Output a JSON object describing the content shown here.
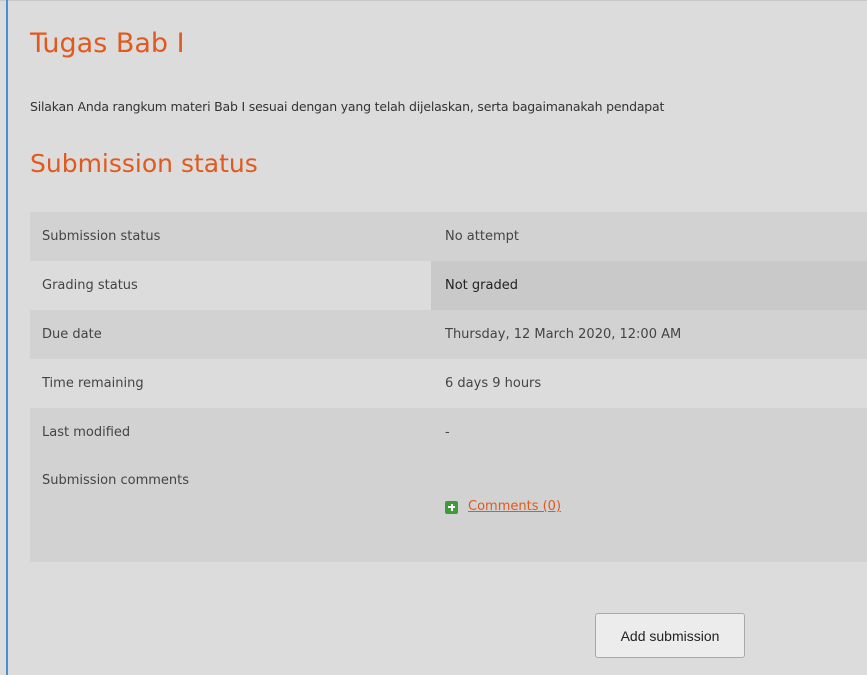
{
  "assignment": {
    "title": "Tugas Bab I",
    "intro": "Silakan Anda rangkum materi Bab I sesuai dengan yang telah dijelaskan, serta bagaimanakah pendapat"
  },
  "submission_status": {
    "heading": "Submission status",
    "rows": [
      {
        "label": "Submission status",
        "value": "No attempt"
      },
      {
        "label": "Grading status",
        "value": "Not graded"
      },
      {
        "label": "Due date",
        "value": "Thursday, 12 March 2020, 12:00 AM"
      },
      {
        "label": "Time remaining",
        "value": "6 days 9 hours"
      },
      {
        "label": "Last modified",
        "value": "-"
      },
      {
        "label": "Submission comments",
        "value": "Comments (0)"
      }
    ]
  },
  "actions": {
    "add_submission_label": "Add submission"
  },
  "icons": {
    "comments": "plus-icon"
  },
  "colors": {
    "accent": "#e2591e",
    "plus_icon": "#3f9b3a",
    "frame_border": "#4a8fd6"
  }
}
